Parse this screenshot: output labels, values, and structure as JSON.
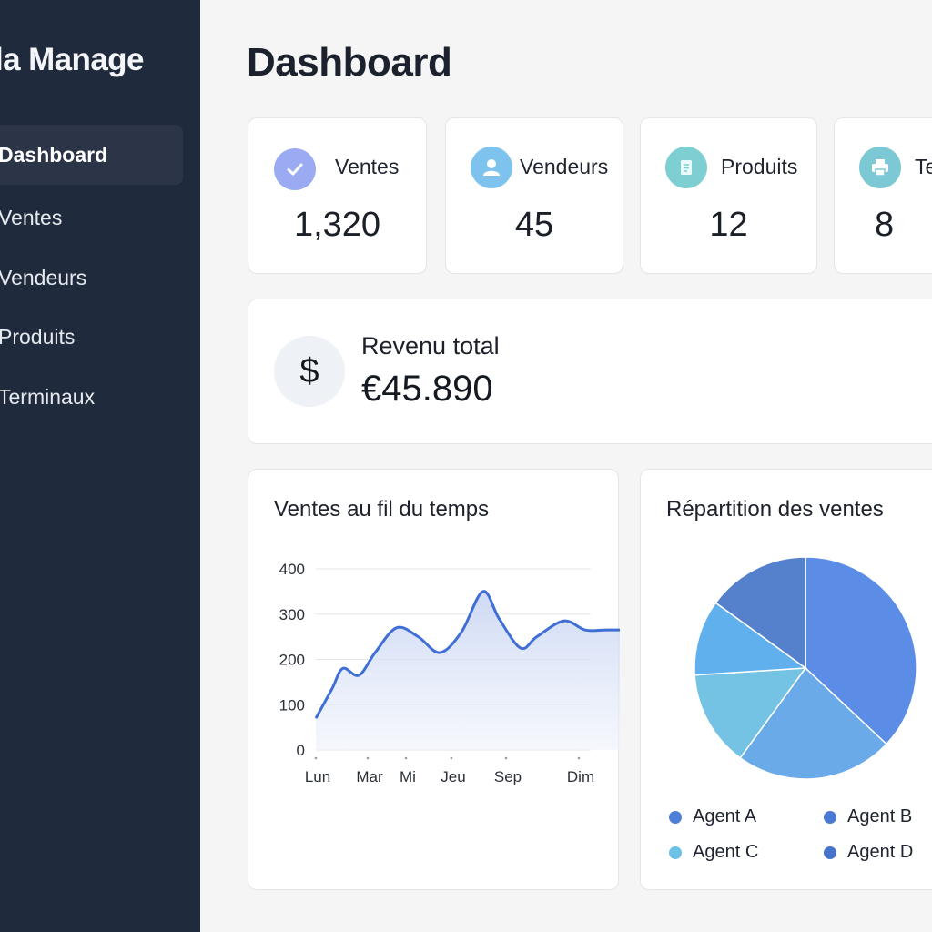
{
  "app": {
    "brand": "la Manage"
  },
  "sidebar": {
    "items": [
      {
        "label": "Dashboard"
      },
      {
        "label": "Ventes"
      },
      {
        "label": "Vendeurs"
      },
      {
        "label": "Produits"
      },
      {
        "label": "Terminaux"
      }
    ]
  },
  "header": {
    "title": "Dashboard"
  },
  "stats": [
    {
      "label": "Ventes",
      "value": "1,320",
      "icon": "check-icon",
      "color": "#8fa2f0"
    },
    {
      "label": "Vendeurs",
      "value": "45",
      "icon": "user-icon",
      "color": "#7ec3ee"
    },
    {
      "label": "Produits",
      "value": "12",
      "icon": "document-icon",
      "color": "#7dcfd2"
    },
    {
      "label": "Te",
      "value": "8",
      "icon": "printer-icon",
      "color": "#7cc8d4"
    }
  ],
  "revenue": {
    "label": "Revenu total",
    "value": "€45.890",
    "icon": "dollar-icon",
    "symbol": "$"
  },
  "charts": {
    "line": {
      "title": "Ventes au fil du temps"
    },
    "pie": {
      "title": "Répartition des ventes"
    }
  },
  "chart_data": [
    {
      "type": "area",
      "title": "Ventes au fil du temps",
      "x_tick_labels": [
        "Lun",
        "Mar",
        "Mi",
        "Jeu",
        "Sep",
        "Dim"
      ],
      "x": [
        0,
        0.3,
        0.5,
        0.8,
        1.1,
        1.5,
        1.9,
        2.3,
        2.7,
        3.1,
        3.4,
        3.8,
        4.1,
        4.6,
        5.0,
        5.4,
        5.9
      ],
      "y": [
        70,
        135,
        180,
        165,
        215,
        270,
        250,
        215,
        260,
        350,
        290,
        225,
        250,
        285,
        265,
        265,
        265
      ],
      "yticks": [
        0,
        100,
        200,
        300,
        400
      ],
      "ylim": [
        0,
        400
      ],
      "grid": true,
      "color": "#3f6fd6"
    },
    {
      "type": "pie",
      "title": "Répartition des ventes",
      "values": [
        37,
        23,
        14,
        11,
        15
      ],
      "colors": [
        "#5c8de6",
        "#6aaae8",
        "#74c3e4",
        "#5fb0ec",
        "#5580cc"
      ],
      "legend": [
        {
          "name": "Agent A",
          "color": "#4e7fd8"
        },
        {
          "name": "Agent B",
          "color": "#4a7ad4"
        },
        {
          "name": "Agent C",
          "color": "#6cc2e6"
        },
        {
          "name": "Agent D",
          "color": "#4673cc"
        }
      ],
      "legend_position": "bottom"
    }
  ]
}
